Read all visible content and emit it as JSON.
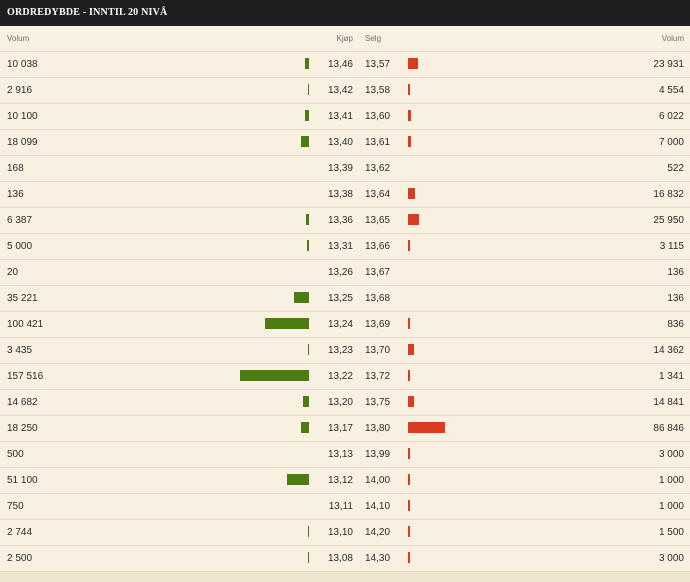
{
  "header": {
    "title": "ORDREDYBDE - INNTIL 20 NIVÅ"
  },
  "columns": {
    "bid_volume": "Volum",
    "bid_price": "Kjøp",
    "ask_price": "Selg",
    "ask_volume": "Volum"
  },
  "colors": {
    "bid_bar": "#4b7d10",
    "ask_bar": "#d93c1e",
    "background": "#f8f1e2",
    "header_bg": "#1f1f1f"
  },
  "rows": [
    {
      "bid_volume": "10 038",
      "bid_price": "13,46",
      "ask_price": "13,57",
      "ask_volume": "23 931"
    },
    {
      "bid_volume": "2 916",
      "bid_price": "13,42",
      "ask_price": "13,58",
      "ask_volume": "4 554"
    },
    {
      "bid_volume": "10 100",
      "bid_price": "13,41",
      "ask_price": "13,60",
      "ask_volume": "6 022"
    },
    {
      "bid_volume": "18 099",
      "bid_price": "13,40",
      "ask_price": "13,61",
      "ask_volume": "7 000"
    },
    {
      "bid_volume": "168",
      "bid_price": "13,39",
      "ask_price": "13,62",
      "ask_volume": "522"
    },
    {
      "bid_volume": "136",
      "bid_price": "13,38",
      "ask_price": "13,64",
      "ask_volume": "16 832"
    },
    {
      "bid_volume": "6 387",
      "bid_price": "13,36",
      "ask_price": "13,65",
      "ask_volume": "25 950"
    },
    {
      "bid_volume": "5 000",
      "bid_price": "13,31",
      "ask_price": "13,66",
      "ask_volume": "3 115"
    },
    {
      "bid_volume": "20",
      "bid_price": "13,26",
      "ask_price": "13,67",
      "ask_volume": "136"
    },
    {
      "bid_volume": "35 221",
      "bid_price": "13,25",
      "ask_price": "13,68",
      "ask_volume": "136"
    },
    {
      "bid_volume": "100 421",
      "bid_price": "13,24",
      "ask_price": "13,69",
      "ask_volume": "836"
    },
    {
      "bid_volume": "3 435",
      "bid_price": "13,23",
      "ask_price": "13,70",
      "ask_volume": "14 362"
    },
    {
      "bid_volume": "157 516",
      "bid_price": "13,22",
      "ask_price": "13,72",
      "ask_volume": "1 341"
    },
    {
      "bid_volume": "14 682",
      "bid_price": "13,20",
      "ask_price": "13,75",
      "ask_volume": "14 841"
    },
    {
      "bid_volume": "18 250",
      "bid_price": "13,17",
      "ask_price": "13,80",
      "ask_volume": "86 846"
    },
    {
      "bid_volume": "500",
      "bid_price": "13,13",
      "ask_price": "13,99",
      "ask_volume": "3 000"
    },
    {
      "bid_volume": "51 100",
      "bid_price": "13,12",
      "ask_price": "14,00",
      "ask_volume": "1 000"
    },
    {
      "bid_volume": "750",
      "bid_price": "13,11",
      "ask_price": "14,10",
      "ask_volume": "1 000"
    },
    {
      "bid_volume": "2 744",
      "bid_price": "13,10",
      "ask_price": "14,20",
      "ask_volume": "1 500"
    },
    {
      "bid_volume": "2 500",
      "bid_price": "13,08",
      "ask_price": "14,30",
      "ask_volume": "3 000"
    }
  ]
}
